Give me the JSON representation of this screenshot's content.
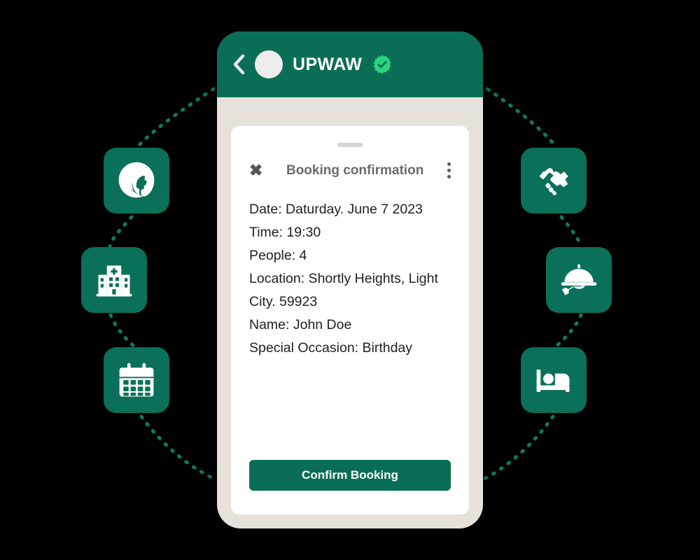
{
  "theme": {
    "background": "#000000",
    "brand_green": "#0A6E55",
    "tile_green": "#0B7059",
    "phone_frame": "#E6E1DB",
    "card_white": "#FFFFFF",
    "badge_green": "#2BD37E",
    "dotted_line": "#0F7A5F"
  },
  "phone": {
    "header": {
      "back_icon": "chevron-left-icon",
      "avatar": "profile-avatar",
      "brand": "UPWAW",
      "verified_icon": "verified-badge-icon"
    }
  },
  "sheet": {
    "drag_handle": "drag-handle",
    "close_label": "✖",
    "title": "Booking confirmation",
    "more_label": "more-options",
    "details": [
      "Date: Daturday. June 7 2023",
      "Time: 19:30",
      "People: 4",
      "Location: Shortly Heights, Light",
      "City. 59923",
      "Name: John Doe",
      "Special Occasion: Birthday"
    ],
    "confirm_label": "Confirm Booking"
  },
  "tiles": [
    {
      "name": "beauty-salon",
      "icon": "beauty-face-icon",
      "side": "left"
    },
    {
      "name": "hospital",
      "icon": "hospital-icon",
      "side": "left"
    },
    {
      "name": "calendar",
      "icon": "calendar-icon",
      "side": "left"
    },
    {
      "name": "partnership",
      "icon": "handshake-icon",
      "side": "right"
    },
    {
      "name": "dining",
      "icon": "room-service-icon",
      "side": "right"
    },
    {
      "name": "hotel",
      "icon": "bed-icon",
      "side": "right"
    }
  ]
}
